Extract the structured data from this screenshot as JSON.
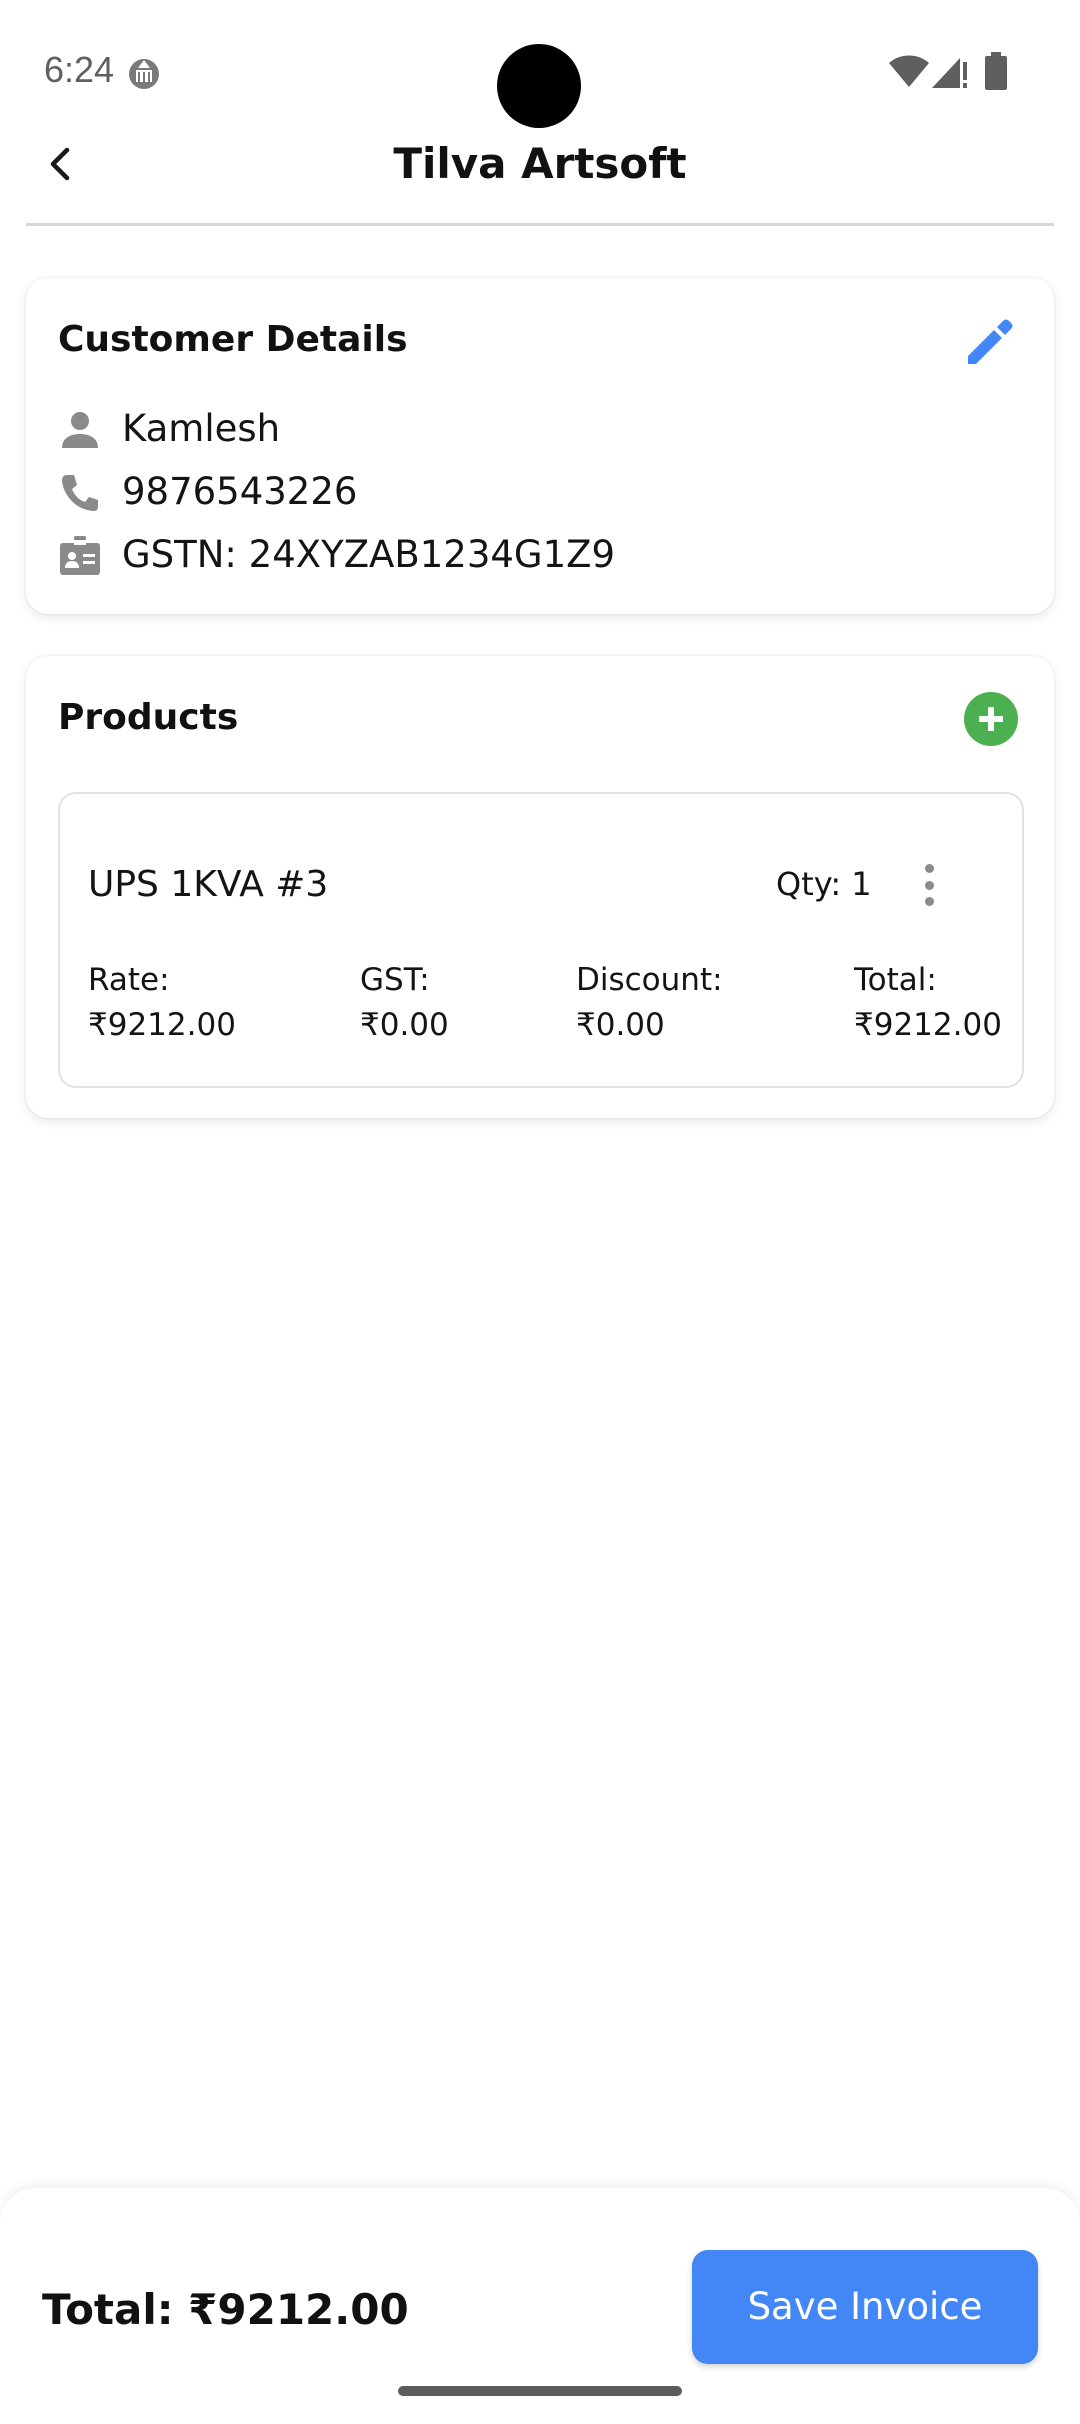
{
  "status_bar": {
    "time": "6:24",
    "icons": [
      "notification-app-icon",
      "wifi-icon",
      "signal-icon",
      "battery-icon"
    ]
  },
  "app_bar": {
    "title": "Tilva Artsoft",
    "back_icon": "chevron-left-icon"
  },
  "customer": {
    "title": "Customer Details",
    "edit_icon": "pencil-icon",
    "name": "Kamlesh",
    "phone": "9876543226",
    "gstn": "GSTN: 24XYZAB1234G1Z9"
  },
  "products": {
    "title": "Products",
    "add_icon": "plus-circle-icon",
    "items": [
      {
        "name": "UPS 1KVA #3",
        "qty": "Qty: 1",
        "rate_label": "Rate:",
        "rate_value": "₹9212.00",
        "gst_label": "GST:",
        "gst_value": "₹0.00",
        "discount_label": "Discount:",
        "discount_value": "₹0.00",
        "total_label": "Total:",
        "total_value": "₹9212.00"
      }
    ]
  },
  "footer": {
    "total": "Total: ₹9212.00",
    "save_label": "Save Invoice"
  },
  "colors": {
    "accent_blue": "#4287f5",
    "add_green": "#4caf50",
    "icon_gray": "#8a8a8a"
  }
}
